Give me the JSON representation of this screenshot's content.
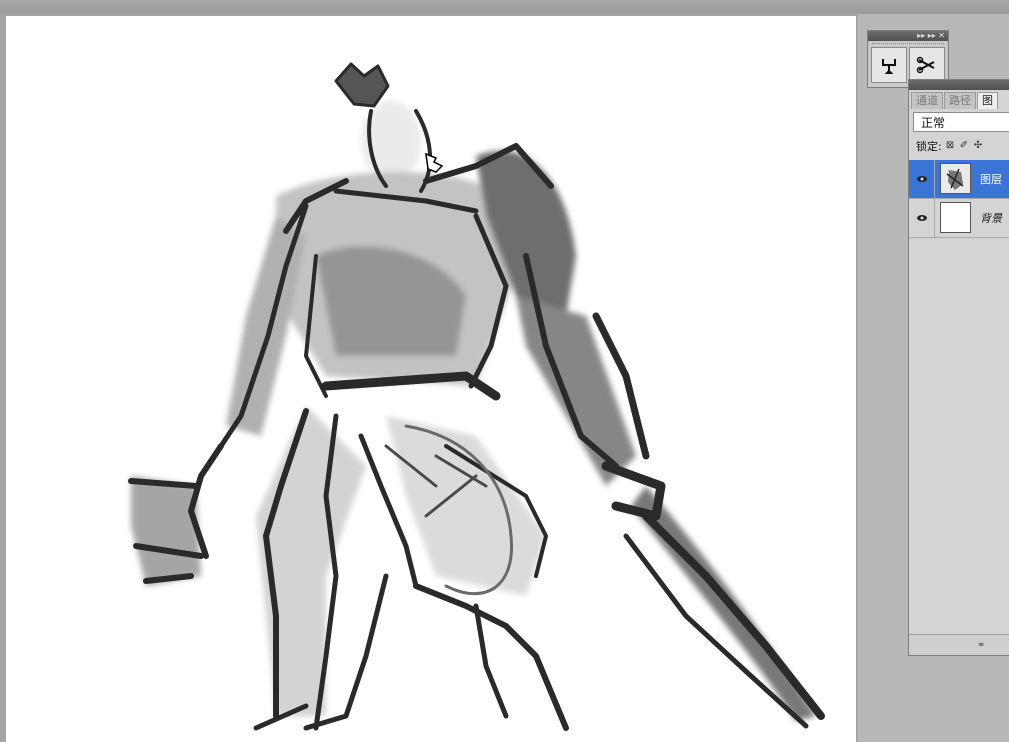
{
  "mini_panel": {
    "title_glyphs": "▸▸ ▸▸ ✕",
    "tools": [
      "usb-like-tool-icon",
      "scissors-tool-icon"
    ]
  },
  "layers_panel": {
    "tabs": [
      {
        "label": "通道",
        "active": false
      },
      {
        "label": "路径",
        "active": false
      },
      {
        "label": "图",
        "active": true
      }
    ],
    "blend_mode": "正常",
    "lock_label": "锁定:",
    "layers": [
      {
        "name": "图层",
        "selected": true,
        "thumb": "sketch-thumbnail"
      },
      {
        "name": "背景",
        "selected": false,
        "thumb": "white-thumbnail"
      }
    ]
  },
  "canvas": {
    "content": "grayscale brush sketch of armored warrior with sword and shield"
  }
}
